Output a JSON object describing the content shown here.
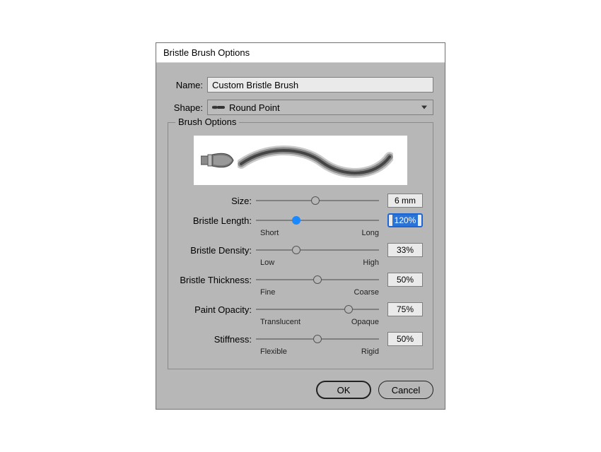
{
  "dialog": {
    "title": "Bristle Brush Options",
    "name_label": "Name:",
    "name_value": "Custom Bristle Brush",
    "shape_label": "Shape:",
    "shape_value": "Round Point",
    "fieldset_legend": "Brush Options",
    "ok_label": "OK",
    "cancel_label": "Cancel"
  },
  "sliders": {
    "size": {
      "label": "Size:",
      "value": "6 mm",
      "pos": 48,
      "low": "",
      "high": "",
      "active": false,
      "highlight": false
    },
    "length": {
      "label": "Bristle Length:",
      "value": "120%",
      "pos": 33,
      "low": "Short",
      "high": "Long",
      "active": true,
      "highlight": true
    },
    "density": {
      "label": "Bristle Density:",
      "value": "33%",
      "pos": 33,
      "low": "Low",
      "high": "High",
      "active": false,
      "highlight": false
    },
    "thickness": {
      "label": "Bristle Thickness:",
      "value": "50%",
      "pos": 50,
      "low": "Fine",
      "high": "Coarse",
      "active": false,
      "highlight": false
    },
    "opacity": {
      "label": "Paint Opacity:",
      "value": "75%",
      "pos": 75,
      "low": "Translucent",
      "high": "Opaque",
      "active": false,
      "highlight": false
    },
    "stiffness": {
      "label": "Stiffness:",
      "value": "50%",
      "pos": 50,
      "low": "Flexible",
      "high": "Rigid",
      "active": false,
      "highlight": false
    }
  }
}
